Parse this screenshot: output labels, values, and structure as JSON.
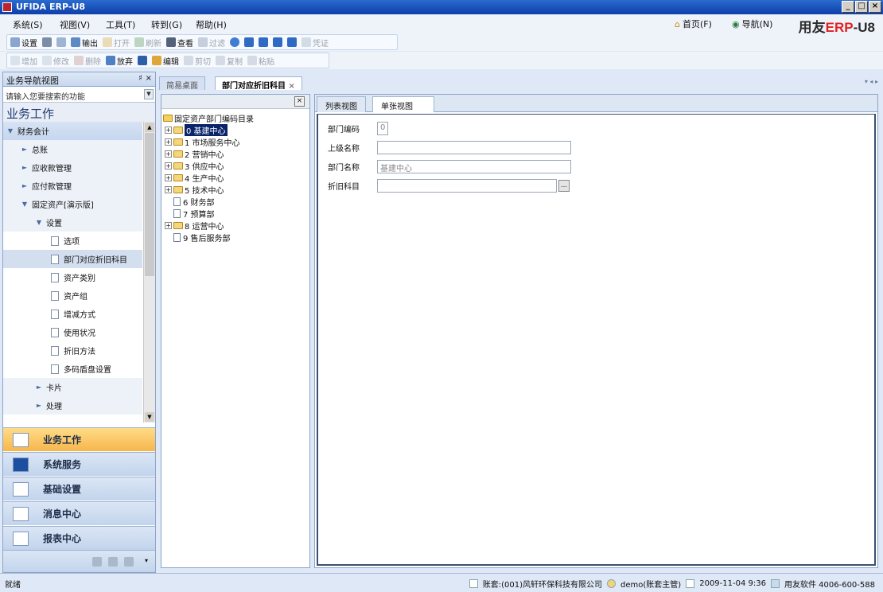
{
  "window": {
    "title": "UFIDA ERP-U8"
  },
  "menubar": {
    "items": [
      "系统(S)",
      "视图(V)",
      "工具(T)",
      "转到(G)",
      "帮助(H)"
    ],
    "home": "首页(F)",
    "nav": "导航(N)",
    "brand_prefix": "用友",
    "brand_erp": "ERP",
    "brand_suffix": "-U8"
  },
  "toolbar1": [
    "设置",
    "输出",
    "打开",
    "刷新",
    "查看",
    "过滤",
    "凭证"
  ],
  "toolbar2": [
    "增加",
    "修改",
    "删除",
    "放弃",
    "编辑",
    "剪切",
    "复制",
    "粘贴"
  ],
  "sidebar": {
    "title": "业务导航视图",
    "search_placeholder": "请输入您要搜索的功能",
    "section": "业务工作",
    "items": [
      {
        "label": "财务会计"
      },
      {
        "label": "总账"
      },
      {
        "label": "应收款管理"
      },
      {
        "label": "应付款管理"
      },
      {
        "label": "固定资产[演示版]"
      },
      {
        "label": "设置"
      },
      {
        "label": "选项"
      },
      {
        "label": "部门对应折旧科目"
      },
      {
        "label": "资产类别"
      },
      {
        "label": "资产组"
      },
      {
        "label": "增减方式"
      },
      {
        "label": "使用状况"
      },
      {
        "label": "折旧方法"
      },
      {
        "label": "多码盾盘设置"
      },
      {
        "label": "卡片"
      },
      {
        "label": "处理"
      }
    ],
    "nav_buttons": [
      "业务工作",
      "系统服务",
      "基础设置",
      "消息中心",
      "报表中心"
    ]
  },
  "tabs": {
    "desktop": "简易桌面",
    "current": "部门对应折旧科目"
  },
  "dept_tree": {
    "root": "固定资产部门编码目录",
    "nodes": [
      {
        "label": "0 基建中心"
      },
      {
        "label": "1 市场服务中心"
      },
      {
        "label": "2 营销中心"
      },
      {
        "label": "3 供应中心"
      },
      {
        "label": "4 生产中心"
      },
      {
        "label": "5 技术中心"
      },
      {
        "label": "6 财务部"
      },
      {
        "label": "7 预算部"
      },
      {
        "label": "8 运营中心"
      },
      {
        "label": "9 售后服务部"
      }
    ]
  },
  "detail": {
    "tab_list": "列表视图",
    "tab_single": "单张视图",
    "dept_code_label": "部门编码",
    "dept_code_value": "0",
    "parent_name_label": "上级名称",
    "parent_name_value": "",
    "dept_name_label": "部门名称",
    "dept_name_value": "基建中心",
    "dep_account_label": "折旧科目",
    "dep_account_value": ""
  },
  "status": {
    "ready": "就绪",
    "account": "账套:(001)风轩环保科技有限公司",
    "user": "demo(账套主管)",
    "datetime": "2009-11-04 9:36",
    "support": "用友软件 4006-600-588"
  }
}
